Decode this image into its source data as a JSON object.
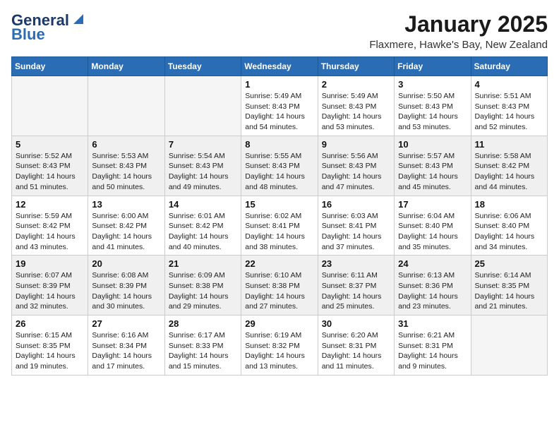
{
  "header": {
    "logo_line1": "General",
    "logo_line2": "Blue",
    "month": "January 2025",
    "location": "Flaxmere, Hawke's Bay, New Zealand"
  },
  "weekdays": [
    "Sunday",
    "Monday",
    "Tuesday",
    "Wednesday",
    "Thursday",
    "Friday",
    "Saturday"
  ],
  "weeks": [
    [
      {
        "day": "",
        "info": ""
      },
      {
        "day": "",
        "info": ""
      },
      {
        "day": "",
        "info": ""
      },
      {
        "day": "1",
        "info": "Sunrise: 5:49 AM\nSunset: 8:43 PM\nDaylight: 14 hours\nand 54 minutes."
      },
      {
        "day": "2",
        "info": "Sunrise: 5:49 AM\nSunset: 8:43 PM\nDaylight: 14 hours\nand 53 minutes."
      },
      {
        "day": "3",
        "info": "Sunrise: 5:50 AM\nSunset: 8:43 PM\nDaylight: 14 hours\nand 53 minutes."
      },
      {
        "day": "4",
        "info": "Sunrise: 5:51 AM\nSunset: 8:43 PM\nDaylight: 14 hours\nand 52 minutes."
      }
    ],
    [
      {
        "day": "5",
        "info": "Sunrise: 5:52 AM\nSunset: 8:43 PM\nDaylight: 14 hours\nand 51 minutes."
      },
      {
        "day": "6",
        "info": "Sunrise: 5:53 AM\nSunset: 8:43 PM\nDaylight: 14 hours\nand 50 minutes."
      },
      {
        "day": "7",
        "info": "Sunrise: 5:54 AM\nSunset: 8:43 PM\nDaylight: 14 hours\nand 49 minutes."
      },
      {
        "day": "8",
        "info": "Sunrise: 5:55 AM\nSunset: 8:43 PM\nDaylight: 14 hours\nand 48 minutes."
      },
      {
        "day": "9",
        "info": "Sunrise: 5:56 AM\nSunset: 8:43 PM\nDaylight: 14 hours\nand 47 minutes."
      },
      {
        "day": "10",
        "info": "Sunrise: 5:57 AM\nSunset: 8:43 PM\nDaylight: 14 hours\nand 45 minutes."
      },
      {
        "day": "11",
        "info": "Sunrise: 5:58 AM\nSunset: 8:42 PM\nDaylight: 14 hours\nand 44 minutes."
      }
    ],
    [
      {
        "day": "12",
        "info": "Sunrise: 5:59 AM\nSunset: 8:42 PM\nDaylight: 14 hours\nand 43 minutes."
      },
      {
        "day": "13",
        "info": "Sunrise: 6:00 AM\nSunset: 8:42 PM\nDaylight: 14 hours\nand 41 minutes."
      },
      {
        "day": "14",
        "info": "Sunrise: 6:01 AM\nSunset: 8:42 PM\nDaylight: 14 hours\nand 40 minutes."
      },
      {
        "day": "15",
        "info": "Sunrise: 6:02 AM\nSunset: 8:41 PM\nDaylight: 14 hours\nand 38 minutes."
      },
      {
        "day": "16",
        "info": "Sunrise: 6:03 AM\nSunset: 8:41 PM\nDaylight: 14 hours\nand 37 minutes."
      },
      {
        "day": "17",
        "info": "Sunrise: 6:04 AM\nSunset: 8:40 PM\nDaylight: 14 hours\nand 35 minutes."
      },
      {
        "day": "18",
        "info": "Sunrise: 6:06 AM\nSunset: 8:40 PM\nDaylight: 14 hours\nand 34 minutes."
      }
    ],
    [
      {
        "day": "19",
        "info": "Sunrise: 6:07 AM\nSunset: 8:39 PM\nDaylight: 14 hours\nand 32 minutes."
      },
      {
        "day": "20",
        "info": "Sunrise: 6:08 AM\nSunset: 8:39 PM\nDaylight: 14 hours\nand 30 minutes."
      },
      {
        "day": "21",
        "info": "Sunrise: 6:09 AM\nSunset: 8:38 PM\nDaylight: 14 hours\nand 29 minutes."
      },
      {
        "day": "22",
        "info": "Sunrise: 6:10 AM\nSunset: 8:38 PM\nDaylight: 14 hours\nand 27 minutes."
      },
      {
        "day": "23",
        "info": "Sunrise: 6:11 AM\nSunset: 8:37 PM\nDaylight: 14 hours\nand 25 minutes."
      },
      {
        "day": "24",
        "info": "Sunrise: 6:13 AM\nSunset: 8:36 PM\nDaylight: 14 hours\nand 23 minutes."
      },
      {
        "day": "25",
        "info": "Sunrise: 6:14 AM\nSunset: 8:35 PM\nDaylight: 14 hours\nand 21 minutes."
      }
    ],
    [
      {
        "day": "26",
        "info": "Sunrise: 6:15 AM\nSunset: 8:35 PM\nDaylight: 14 hours\nand 19 minutes."
      },
      {
        "day": "27",
        "info": "Sunrise: 6:16 AM\nSunset: 8:34 PM\nDaylight: 14 hours\nand 17 minutes."
      },
      {
        "day": "28",
        "info": "Sunrise: 6:17 AM\nSunset: 8:33 PM\nDaylight: 14 hours\nand 15 minutes."
      },
      {
        "day": "29",
        "info": "Sunrise: 6:19 AM\nSunset: 8:32 PM\nDaylight: 14 hours\nand 13 minutes."
      },
      {
        "day": "30",
        "info": "Sunrise: 6:20 AM\nSunset: 8:31 PM\nDaylight: 14 hours\nand 11 minutes."
      },
      {
        "day": "31",
        "info": "Sunrise: 6:21 AM\nSunset: 8:31 PM\nDaylight: 14 hours\nand 9 minutes."
      },
      {
        "day": "",
        "info": ""
      }
    ]
  ]
}
